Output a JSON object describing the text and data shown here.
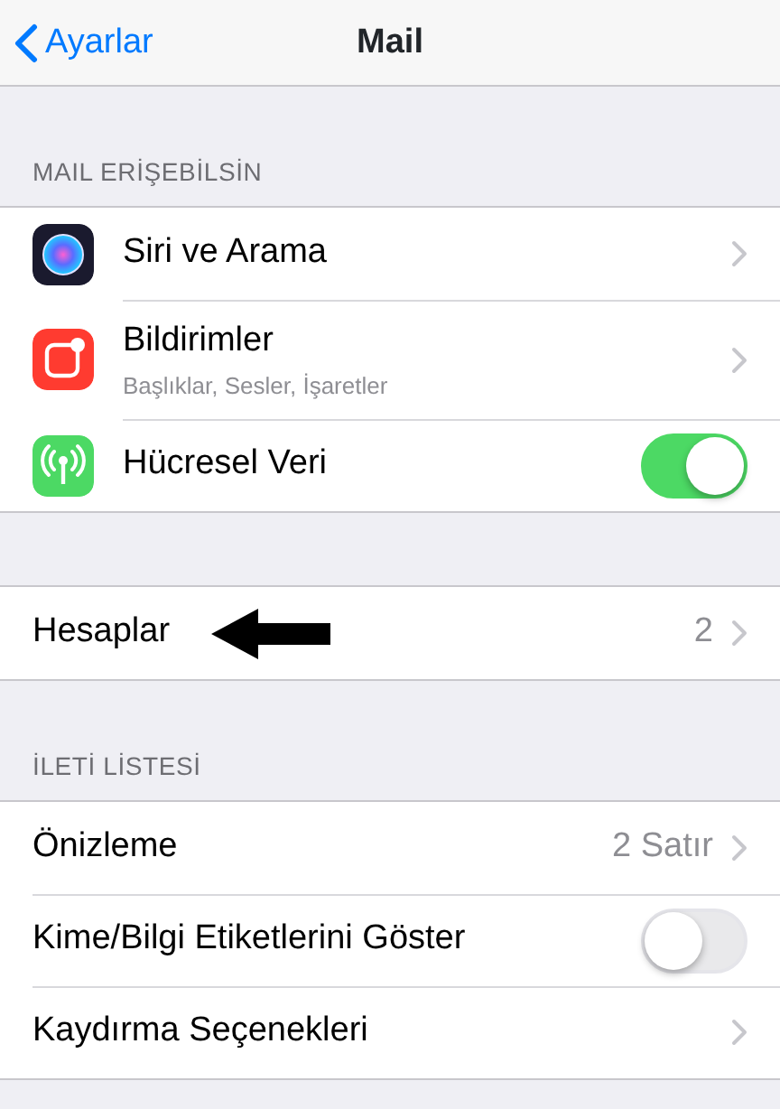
{
  "nav": {
    "back": "Ayarlar",
    "title": "Mail"
  },
  "sections": [
    {
      "header": "MAIL ERİŞEBİLSİN",
      "rows": [
        {
          "kind": "link",
          "label": "Siri ve Arama"
        },
        {
          "kind": "link",
          "label": "Bildirimler",
          "subtitle": "Başlıklar, Sesler, İşaretler"
        },
        {
          "kind": "toggle",
          "label": "Hücresel Veri",
          "on": true
        }
      ]
    },
    {
      "rows": [
        {
          "kind": "link",
          "label": "Hesaplar",
          "value": "2",
          "pointer_arrow": true
        }
      ]
    },
    {
      "header": "İLETİ LİSTESİ",
      "rows": [
        {
          "kind": "link",
          "label": "Önizleme",
          "value": "2 Satır"
        },
        {
          "kind": "toggle",
          "label": "Kime/Bilgi Etiketlerini Göster",
          "on": false
        },
        {
          "kind": "link",
          "label": "Kaydırma Seçenekleri"
        }
      ]
    }
  ]
}
